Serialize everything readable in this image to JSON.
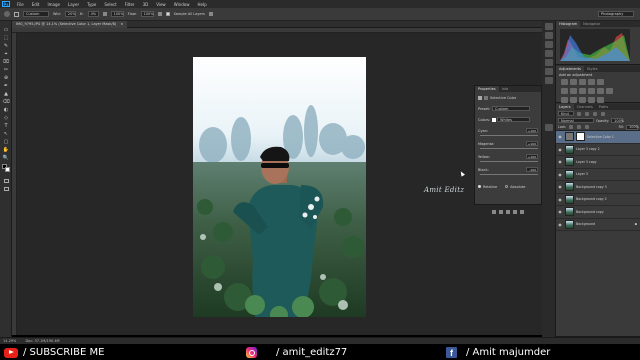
{
  "menubar": {
    "logo": "Ps",
    "items": [
      "File",
      "Edit",
      "Image",
      "Layer",
      "Type",
      "Select",
      "Filter",
      "3D",
      "View",
      "Window",
      "Help"
    ]
  },
  "options": {
    "style": "Custom",
    "width_label": "Wid:",
    "width_val": "20%",
    "height_label": "H:",
    "height_val": "4%",
    "size_val": "100%",
    "flow_label": "Flow:",
    "flow_val": "100%",
    "sample_label": "Sample All Layers",
    "workspace": "Photography"
  },
  "document": {
    "tab": "IMG_9795.JPG @ 14.1% (Selective Color 1, Layer Mask/8)",
    "close": "×",
    "zoom": "14.29%",
    "doc_size": "Doc: 37.1M/190.4M"
  },
  "toolbar": {
    "tools": [
      "▭",
      "⬚",
      "✎",
      "⌖",
      "⌧",
      "✂",
      "⊕",
      "✒",
      "▲",
      "⌫",
      "◐",
      "◇",
      "T",
      "↖",
      "▢",
      "✋",
      "🔍"
    ]
  },
  "properties": {
    "tabs": [
      "Properties",
      "Info"
    ],
    "title": "Selective Color",
    "preset_label": "Preset:",
    "preset_val": "Custom",
    "colors_label": "Colors:",
    "colors_val": "Whites",
    "rows": [
      {
        "label": "Cyan:",
        "value": "+100"
      },
      {
        "label": "Magenta:",
        "value": "+100"
      },
      {
        "label": "Yellow:",
        "value": "+100"
      },
      {
        "label": "Black:",
        "value": "-100"
      }
    ],
    "relative": "Relative",
    "absolute": "Absolute"
  },
  "histogram": {
    "tabs": [
      "Histogram",
      "Navigator"
    ]
  },
  "adjustments": {
    "tabs": [
      "Adjustments",
      "Styles"
    ],
    "hint": "Add an adjustment"
  },
  "layers": {
    "tabs": [
      "Layers",
      "Channels",
      "Paths"
    ],
    "kind": "Kind",
    "blend": "Normal",
    "opacity_label": "Opacity:",
    "opacity_val": "100%",
    "lock_label": "Lock:",
    "fill_label": "Fill:",
    "fill_val": "100%",
    "items": [
      {
        "name": "Selective Color 1",
        "selected": true
      },
      {
        "name": "Layer 3 copy 2",
        "selected": false
      },
      {
        "name": "Layer 3 copy",
        "selected": false
      },
      {
        "name": "Layer 3",
        "selected": false
      },
      {
        "name": "Background copy 3",
        "selected": false
      },
      {
        "name": "Background copy 2",
        "selected": false
      },
      {
        "name": "Background copy",
        "selected": false
      },
      {
        "name": "Background",
        "selected": false
      }
    ]
  },
  "watermark": "Amit Editz",
  "footer": {
    "subscribe": "/ SUBSCRIBE ME",
    "instagram": "/ amit_editz77",
    "facebook": "/ Amit majumder"
  },
  "colors": {
    "accent": "#31a8ff",
    "youtube": "#e62117",
    "facebook": "#3b5998"
  }
}
